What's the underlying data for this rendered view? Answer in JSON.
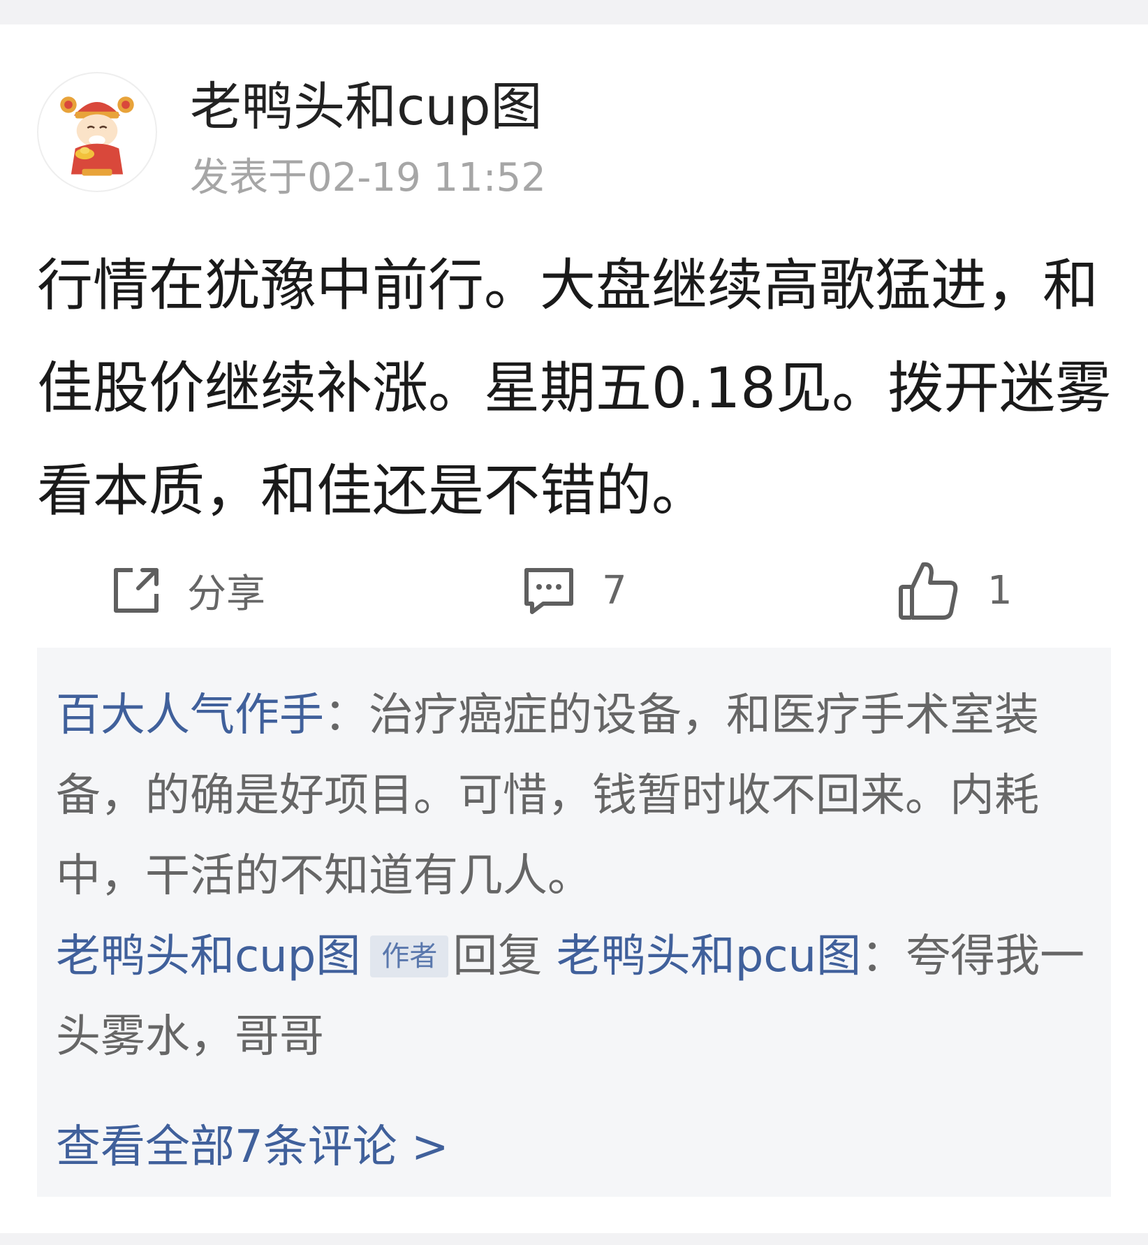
{
  "post": {
    "author": "老鸭头和cup图",
    "time": "发表于02-19 11:52",
    "content": "行情在犹豫中前行。大盘继续高歌猛进，和佳股价继续补涨。星期五0.18见。拨开迷雾看本质，和佳还是不错的。",
    "avatar_icon": "caishen-avatar-icon"
  },
  "actions": {
    "share_label": "分享",
    "comment_count": "7",
    "like_count": "1",
    "share_icon": "share-icon",
    "comment_icon": "comment-icon",
    "like_icon": "thumbs-up-icon"
  },
  "comments": [
    {
      "user": "百大人气作手",
      "separator": "：",
      "text": "治疗癌症的设备，和医疗手术室装备，的确是好项目。可惜，钱暂时收不回来。内耗中，干活的不知道有几人。"
    },
    {
      "user": "老鸭头和cup图",
      "badge": "作者",
      "reply_word": "回复",
      "reply_to": "老鸭头和pcu图",
      "separator": "：",
      "text": "夸得我一头雾水，哥哥"
    }
  ],
  "view_all": "查看全部7条评论 >",
  "colors": {
    "link_blue": "#40609b",
    "comment_bg": "#f5f6f8",
    "page_bg": "#f2f2f4",
    "body_text": "#1a1a1a",
    "muted": "#a6a6a6"
  }
}
